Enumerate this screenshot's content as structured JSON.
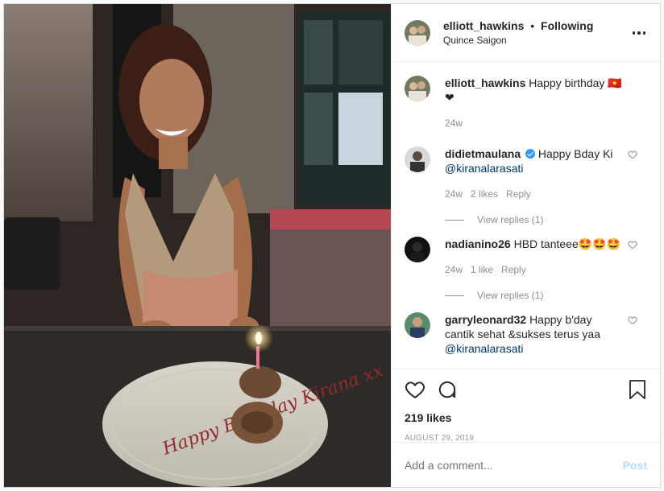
{
  "header": {
    "username": "elliott_hawkins",
    "separator": "•",
    "follow_status": "Following",
    "location": "Quince Saigon"
  },
  "comments": [
    {
      "username": "elliott_hawkins",
      "text": "Happy birthday 🇻🇳❤",
      "time": "24w"
    },
    {
      "username": "didietmaulana",
      "verified": true,
      "text": "Happy Bday Ki",
      "mention": "@kiranalarasati",
      "time": "24w",
      "likes": "2 likes",
      "reply": "Reply",
      "view_replies": "View replies (1)"
    },
    {
      "username": "nadianino26",
      "text": "HBD tanteee🤩🤩🤩",
      "time": "24w",
      "likes": "1 like",
      "reply": "Reply",
      "view_replies": "View replies (1)"
    },
    {
      "username": "garryleonard32",
      "text": "Happy b'day cantik sehat &sukses terus yaa",
      "mention": "@kiranalarasati"
    }
  ],
  "post": {
    "likes": "219 likes",
    "date": "AUGUST 29, 2019"
  },
  "comment_box": {
    "placeholder": "Add a comment...",
    "post_label": "Post"
  },
  "photo": {
    "plate_text": "Happy Birthday Kirana xx"
  },
  "icons": [
    "more-icon",
    "heart-icon",
    "comment-icon",
    "bookmark-icon",
    "verified-icon"
  ],
  "colors": {
    "mention": "#003569",
    "verified": "#3897f0",
    "post_disabled": "#b2dffc"
  }
}
